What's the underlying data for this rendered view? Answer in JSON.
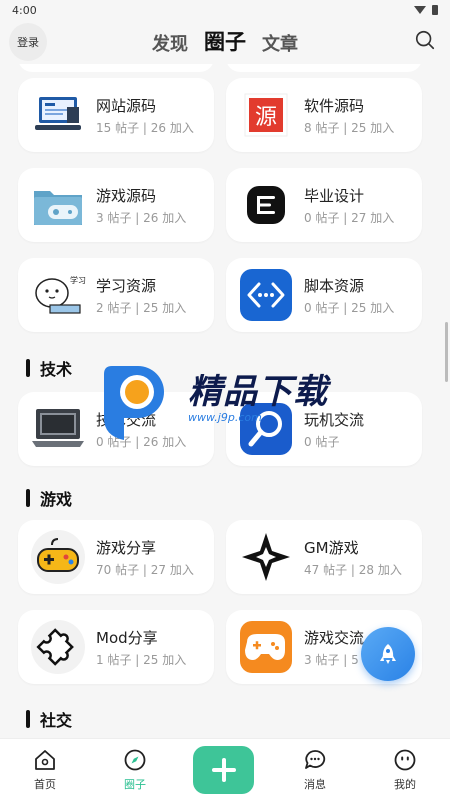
{
  "status": {
    "time": "4:00"
  },
  "header": {
    "login_label": "登录",
    "tabs": [
      {
        "label": "发现"
      },
      {
        "label": "圈子"
      },
      {
        "label": "文章"
      }
    ]
  },
  "rows": [
    [
      {
        "name": "网站源码",
        "posts": "15 帖子",
        "joins": "26 加入",
        "icon": "website-source-icon"
      },
      {
        "name": "软件源码",
        "posts": "8 帖子",
        "joins": "25 加入",
        "icon": "software-source-icon"
      }
    ],
    [
      {
        "name": "游戏源码",
        "posts": "3 帖子",
        "joins": "26 加入",
        "icon": "game-source-icon"
      },
      {
        "name": "毕业设计",
        "posts": "0 帖子",
        "joins": "27 加入",
        "icon": "graduation-design-icon"
      }
    ],
    [
      {
        "name": "学习资源",
        "posts": "2 帖子",
        "joins": "25 加入",
        "icon": "study-resource-icon"
      },
      {
        "name": "脚本资源",
        "posts": "0 帖子",
        "joins": "25 加入",
        "icon": "script-resource-icon"
      }
    ]
  ],
  "sections": {
    "tech": {
      "title": "技术",
      "items": [
        {
          "name": "技术交流",
          "posts": "0 帖子",
          "joins": "26 加入",
          "icon": "laptop-icon"
        },
        {
          "name": "玩机交流",
          "posts": "0 帖子",
          "joins": "",
          "icon": "wrench-icon"
        }
      ]
    },
    "game": {
      "title": "游戏",
      "items": [
        {
          "name": "游戏分享",
          "posts": "70 帖子",
          "joins": "27 加入",
          "icon": "gamepad-icon"
        },
        {
          "name": "GM游戏",
          "posts": "47 帖子",
          "joins": "28 加入",
          "icon": "gm-game-icon"
        },
        {
          "name": "Mod分享",
          "posts": "1 帖子",
          "joins": "25 加入",
          "icon": "puzzle-icon"
        },
        {
          "name": "游戏交流",
          "posts": "3 帖子",
          "joins": "5",
          "icon": "game-chat-icon"
        }
      ]
    },
    "social": {
      "title": "社交"
    }
  },
  "watermark": {
    "text": "精品下载",
    "url": "www.j9p.com"
  },
  "nav": [
    {
      "label": "首页"
    },
    {
      "label": "圈子"
    },
    {
      "label": "消息"
    },
    {
      "label": "我的"
    }
  ],
  "colors": {
    "accent": "#3ec598",
    "fab": "#2a82e6"
  }
}
